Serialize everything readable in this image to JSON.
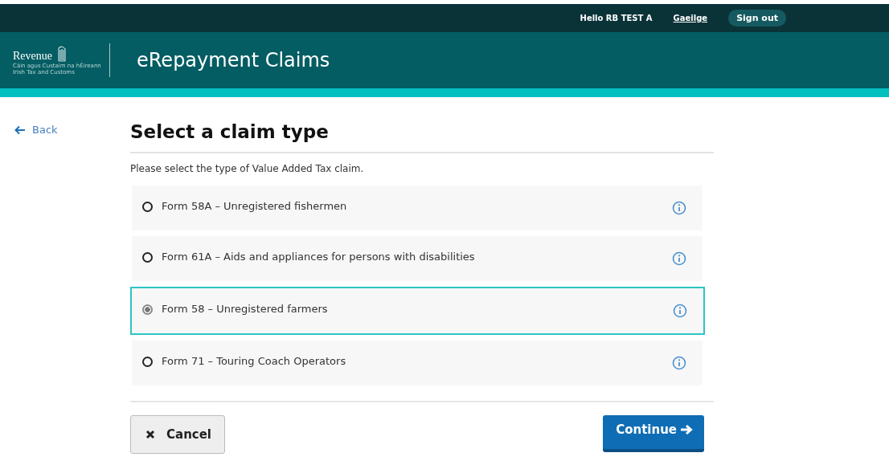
{
  "top_bar": {
    "greeting": "Hello RB TEST A",
    "language_link": "Gaeilge",
    "sign_out": "Sign out"
  },
  "header": {
    "logo": {
      "name": "Revenue",
      "subtitle": "Cáin agus Custaim na hÉireann Irish Tax and Customs"
    },
    "title": "eRepayment Claims"
  },
  "back_link": "Back",
  "heading": "Select a claim type",
  "intro": "Please select the type of Value Added Tax claim.",
  "options": [
    {
      "label": "Form 58A – Unregistered fishermen",
      "selected": false
    },
    {
      "label": "Form 61A – Aids and appliances for persons with disabilities",
      "selected": false
    },
    {
      "label": "Form 58 – Unregistered farmers",
      "selected": true
    },
    {
      "label": "Form 71 – Touring Coach Operators",
      "selected": false
    }
  ],
  "buttons": {
    "cancel": "Cancel",
    "continue": "Continue"
  }
}
